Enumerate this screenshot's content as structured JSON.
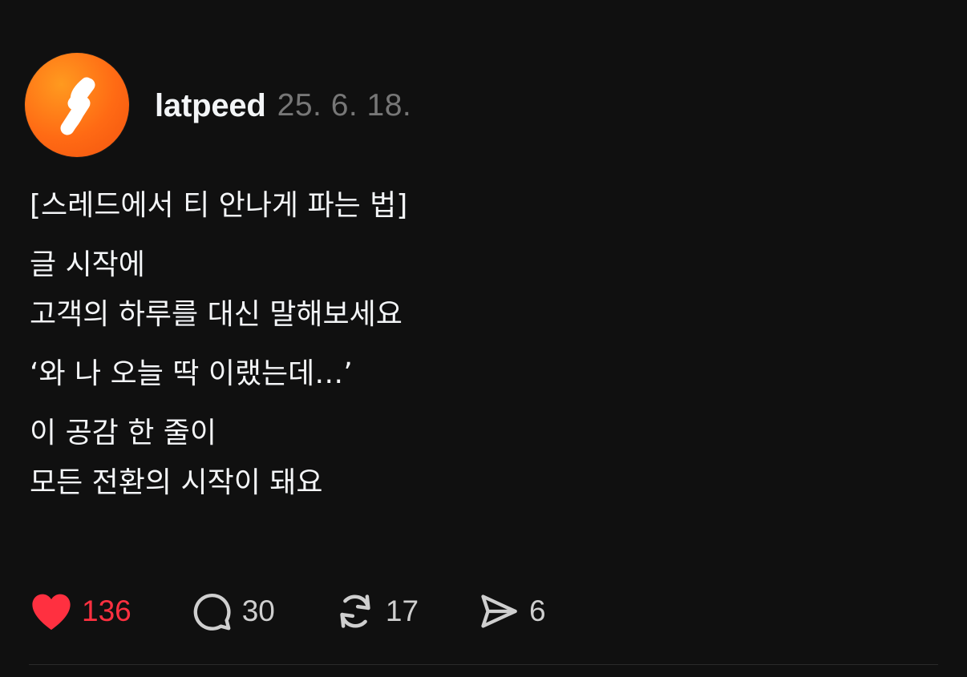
{
  "post": {
    "author": {
      "username": "latpeed",
      "avatar_icon": "latpeed-logo-icon",
      "avatar_color": "#ff6a14"
    },
    "timestamp": "25. 6. 18.",
    "lines": {
      "title": "[스레드에서 티 안나게 파는 법]",
      "p1_l1": "글 시작에",
      "p1_l2": "고객의 하루를 대신 말해보세요",
      "p2_l1": "‘와 나 오늘 딱 이랬는데…’",
      "p3_l1": "이 공감 한 줄이",
      "p3_l2": "모든 전환의 시작이 돼요"
    },
    "actions": {
      "like": {
        "icon": "heart-icon",
        "count": "136",
        "liked": true,
        "color": "#ff3040"
      },
      "comment": {
        "icon": "comment-bubble-icon",
        "count": "30"
      },
      "repost": {
        "icon": "repost-icon",
        "count": "17"
      },
      "share": {
        "icon": "send-icon",
        "count": "6"
      }
    }
  }
}
